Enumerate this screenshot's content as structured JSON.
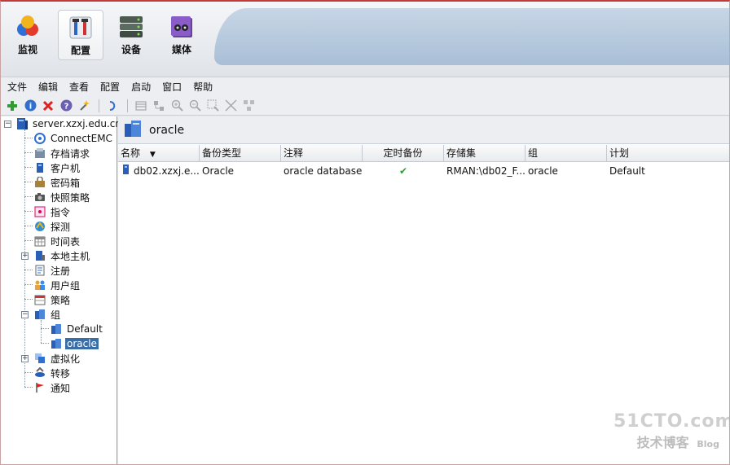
{
  "nav": {
    "items": [
      {
        "label": "监视",
        "icon": "monitor-icon"
      },
      {
        "label": "配置",
        "icon": "configure-icon"
      },
      {
        "label": "设备",
        "icon": "devices-icon"
      },
      {
        "label": "媒体",
        "icon": "media-icon"
      }
    ],
    "active": "配置"
  },
  "menu": {
    "items": [
      "文件",
      "编辑",
      "查看",
      "配置",
      "启动",
      "窗口",
      "帮助"
    ]
  },
  "toolbar": {
    "icons": [
      "add-icon",
      "info-icon",
      "delete-icon",
      "help-icon",
      "wand-icon",
      "undo-icon",
      "list-view-icon",
      "tree-view-icon",
      "zoom-in-icon",
      "zoom-out-icon",
      "select-icon",
      "fit-icon",
      "layout-icon"
    ]
  },
  "tree": {
    "root": "server.xzxj.edu.cn",
    "items": [
      {
        "label": "ConnectEMC"
      },
      {
        "label": "存档请求"
      },
      {
        "label": "客户机"
      },
      {
        "label": "密码箱"
      },
      {
        "label": "快照策略"
      },
      {
        "label": "指令"
      },
      {
        "label": "探测"
      },
      {
        "label": "时间表"
      },
      {
        "label": "本地主机"
      },
      {
        "label": "注册"
      },
      {
        "label": "用户组"
      },
      {
        "label": "策略"
      },
      {
        "label": "组"
      },
      {
        "label": "Default"
      },
      {
        "label": "oracle"
      },
      {
        "label": "虚拟化"
      },
      {
        "label": "转移"
      },
      {
        "label": "通知"
      }
    ],
    "selected": "oracle"
  },
  "content": {
    "title": "oracle",
    "columns": [
      "名称",
      "备份类型",
      "注释",
      "定时备份",
      "存储集",
      "组",
      "计划"
    ],
    "rows": [
      {
        "name": "db02.xzxj.e...",
        "type": "Oracle",
        "comment": "oracle database",
        "scheduled": "✔",
        "storage": "RMAN:\\db02_F...",
        "group": "oracle",
        "plan": "Default"
      }
    ]
  },
  "watermark": {
    "line1": "51CTO.com",
    "line2": "技术博客",
    "line3": "Blog"
  },
  "colors": {
    "accent": "#3b6ea5",
    "nav_wave": "#b4c7dc",
    "check_green": "#2e9d32"
  }
}
